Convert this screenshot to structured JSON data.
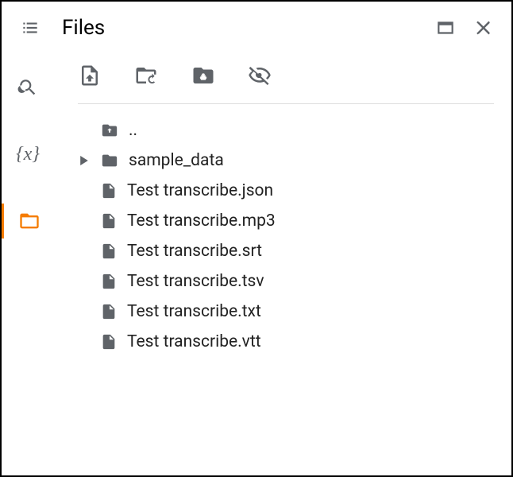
{
  "header": {
    "title": "Files"
  },
  "toolbar": {
    "upload": "Upload",
    "refresh": "Refresh",
    "mount_drive": "Mount Drive",
    "hide": "Toggle hidden"
  },
  "files": {
    "parent": "..",
    "items": [
      {
        "name": "sample_data",
        "type": "folder",
        "expandable": true
      },
      {
        "name": "Test transcribe.json",
        "type": "file"
      },
      {
        "name": "Test transcribe.mp3",
        "type": "file"
      },
      {
        "name": "Test transcribe.srt",
        "type": "file"
      },
      {
        "name": "Test transcribe.tsv",
        "type": "file"
      },
      {
        "name": "Test transcribe.txt",
        "type": "file"
      },
      {
        "name": "Test transcribe.vtt",
        "type": "file"
      }
    ]
  },
  "sidebar": {
    "toc": "Table of contents",
    "search": "Find and replace",
    "variables": "Variables",
    "files": "Files"
  }
}
